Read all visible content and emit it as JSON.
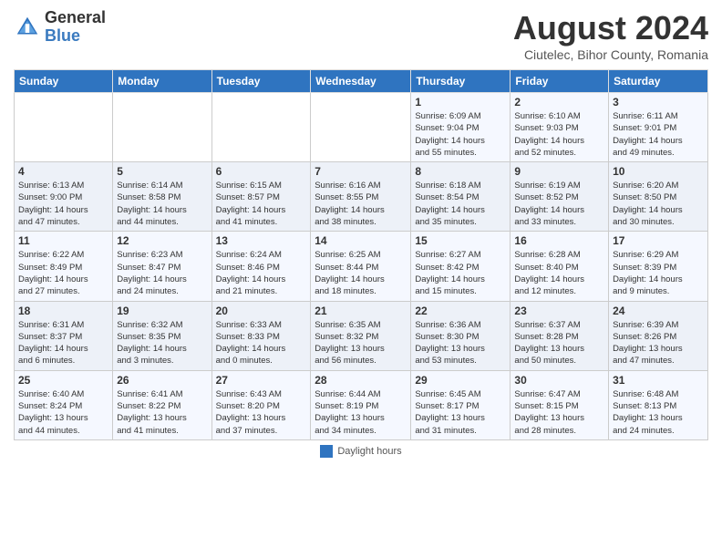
{
  "header": {
    "logo_general": "General",
    "logo_blue": "Blue",
    "main_title": "August 2024",
    "subtitle": "Ciutelec, Bihor County, Romania"
  },
  "footer": {
    "legend_label": "Daylight hours"
  },
  "calendar": {
    "headers": [
      "Sunday",
      "Monday",
      "Tuesday",
      "Wednesday",
      "Thursday",
      "Friday",
      "Saturday"
    ],
    "weeks": [
      {
        "days": [
          {
            "num": "",
            "info": ""
          },
          {
            "num": "",
            "info": ""
          },
          {
            "num": "",
            "info": ""
          },
          {
            "num": "",
            "info": ""
          },
          {
            "num": "1",
            "info": "Sunrise: 6:09 AM\nSunset: 9:04 PM\nDaylight: 14 hours\nand 55 minutes."
          },
          {
            "num": "2",
            "info": "Sunrise: 6:10 AM\nSunset: 9:03 PM\nDaylight: 14 hours\nand 52 minutes."
          },
          {
            "num": "3",
            "info": "Sunrise: 6:11 AM\nSunset: 9:01 PM\nDaylight: 14 hours\nand 49 minutes."
          }
        ]
      },
      {
        "days": [
          {
            "num": "4",
            "info": "Sunrise: 6:13 AM\nSunset: 9:00 PM\nDaylight: 14 hours\nand 47 minutes."
          },
          {
            "num": "5",
            "info": "Sunrise: 6:14 AM\nSunset: 8:58 PM\nDaylight: 14 hours\nand 44 minutes."
          },
          {
            "num": "6",
            "info": "Sunrise: 6:15 AM\nSunset: 8:57 PM\nDaylight: 14 hours\nand 41 minutes."
          },
          {
            "num": "7",
            "info": "Sunrise: 6:16 AM\nSunset: 8:55 PM\nDaylight: 14 hours\nand 38 minutes."
          },
          {
            "num": "8",
            "info": "Sunrise: 6:18 AM\nSunset: 8:54 PM\nDaylight: 14 hours\nand 35 minutes."
          },
          {
            "num": "9",
            "info": "Sunrise: 6:19 AM\nSunset: 8:52 PM\nDaylight: 14 hours\nand 33 minutes."
          },
          {
            "num": "10",
            "info": "Sunrise: 6:20 AM\nSunset: 8:50 PM\nDaylight: 14 hours\nand 30 minutes."
          }
        ]
      },
      {
        "days": [
          {
            "num": "11",
            "info": "Sunrise: 6:22 AM\nSunset: 8:49 PM\nDaylight: 14 hours\nand 27 minutes."
          },
          {
            "num": "12",
            "info": "Sunrise: 6:23 AM\nSunset: 8:47 PM\nDaylight: 14 hours\nand 24 minutes."
          },
          {
            "num": "13",
            "info": "Sunrise: 6:24 AM\nSunset: 8:46 PM\nDaylight: 14 hours\nand 21 minutes."
          },
          {
            "num": "14",
            "info": "Sunrise: 6:25 AM\nSunset: 8:44 PM\nDaylight: 14 hours\nand 18 minutes."
          },
          {
            "num": "15",
            "info": "Sunrise: 6:27 AM\nSunset: 8:42 PM\nDaylight: 14 hours\nand 15 minutes."
          },
          {
            "num": "16",
            "info": "Sunrise: 6:28 AM\nSunset: 8:40 PM\nDaylight: 14 hours\nand 12 minutes."
          },
          {
            "num": "17",
            "info": "Sunrise: 6:29 AM\nSunset: 8:39 PM\nDaylight: 14 hours\nand 9 minutes."
          }
        ]
      },
      {
        "days": [
          {
            "num": "18",
            "info": "Sunrise: 6:31 AM\nSunset: 8:37 PM\nDaylight: 14 hours\nand 6 minutes."
          },
          {
            "num": "19",
            "info": "Sunrise: 6:32 AM\nSunset: 8:35 PM\nDaylight: 14 hours\nand 3 minutes."
          },
          {
            "num": "20",
            "info": "Sunrise: 6:33 AM\nSunset: 8:33 PM\nDaylight: 14 hours\nand 0 minutes."
          },
          {
            "num": "21",
            "info": "Sunrise: 6:35 AM\nSunset: 8:32 PM\nDaylight: 13 hours\nand 56 minutes."
          },
          {
            "num": "22",
            "info": "Sunrise: 6:36 AM\nSunset: 8:30 PM\nDaylight: 13 hours\nand 53 minutes."
          },
          {
            "num": "23",
            "info": "Sunrise: 6:37 AM\nSunset: 8:28 PM\nDaylight: 13 hours\nand 50 minutes."
          },
          {
            "num": "24",
            "info": "Sunrise: 6:39 AM\nSunset: 8:26 PM\nDaylight: 13 hours\nand 47 minutes."
          }
        ]
      },
      {
        "days": [
          {
            "num": "25",
            "info": "Sunrise: 6:40 AM\nSunset: 8:24 PM\nDaylight: 13 hours\nand 44 minutes."
          },
          {
            "num": "26",
            "info": "Sunrise: 6:41 AM\nSunset: 8:22 PM\nDaylight: 13 hours\nand 41 minutes."
          },
          {
            "num": "27",
            "info": "Sunrise: 6:43 AM\nSunset: 8:20 PM\nDaylight: 13 hours\nand 37 minutes."
          },
          {
            "num": "28",
            "info": "Sunrise: 6:44 AM\nSunset: 8:19 PM\nDaylight: 13 hours\nand 34 minutes."
          },
          {
            "num": "29",
            "info": "Sunrise: 6:45 AM\nSunset: 8:17 PM\nDaylight: 13 hours\nand 31 minutes."
          },
          {
            "num": "30",
            "info": "Sunrise: 6:47 AM\nSunset: 8:15 PM\nDaylight: 13 hours\nand 28 minutes."
          },
          {
            "num": "31",
            "info": "Sunrise: 6:48 AM\nSunset: 8:13 PM\nDaylight: 13 hours\nand 24 minutes."
          }
        ]
      }
    ]
  }
}
